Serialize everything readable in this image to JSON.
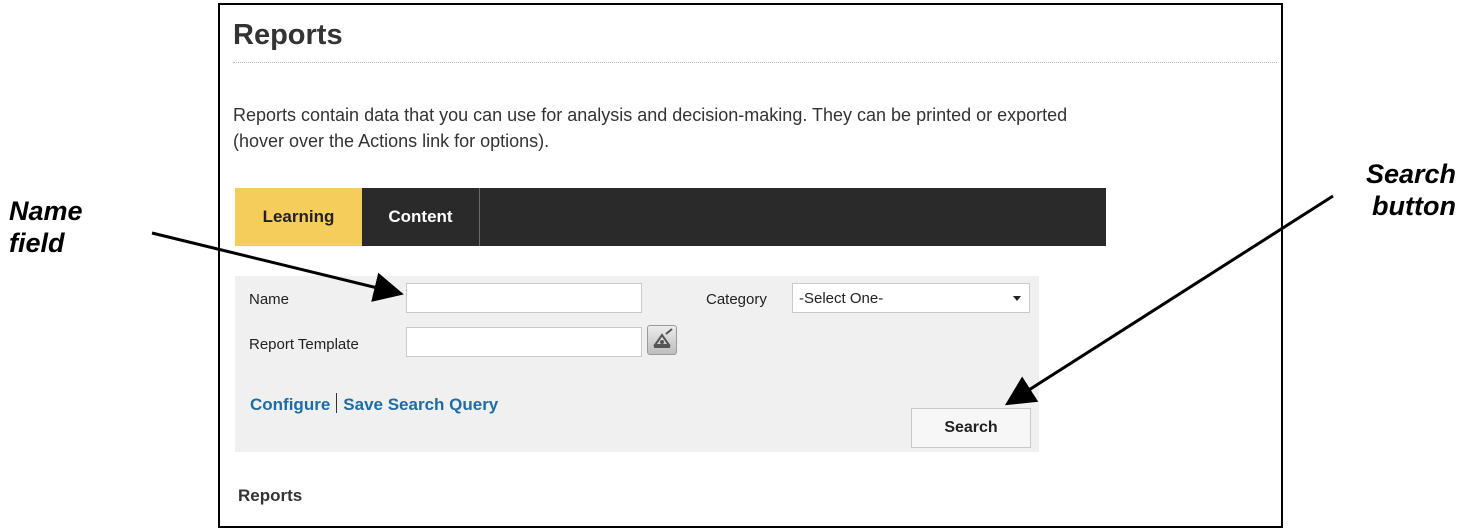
{
  "callouts": {
    "name_field_line1": "Name",
    "name_field_line2": "field",
    "search_button_line1": "Search",
    "search_button_line2": "button"
  },
  "page": {
    "title": "Reports",
    "description_line1": "Reports contain data that you can use for analysis and decision-making. They can be printed or exported",
    "description_line2": "(hover over the Actions link for options)."
  },
  "tabs": [
    {
      "label": "Learning",
      "active": true
    },
    {
      "label": "Content",
      "active": false
    }
  ],
  "search": {
    "name_label": "Name",
    "name_value": "",
    "template_label": "Report Template",
    "template_value": "",
    "template_picker_icon": "picker-icon",
    "category_label": "Category",
    "category_selected": "-Select One-",
    "links": {
      "configure": "Configure",
      "save_query": "Save Search Query"
    },
    "search_button": "Search"
  },
  "results": {
    "heading": "Reports"
  },
  "colors": {
    "active_tab": "#f5cd5a",
    "tab_bar": "#2a2a2a",
    "link": "#1e6ca3",
    "panel": "#f0f0f0"
  }
}
